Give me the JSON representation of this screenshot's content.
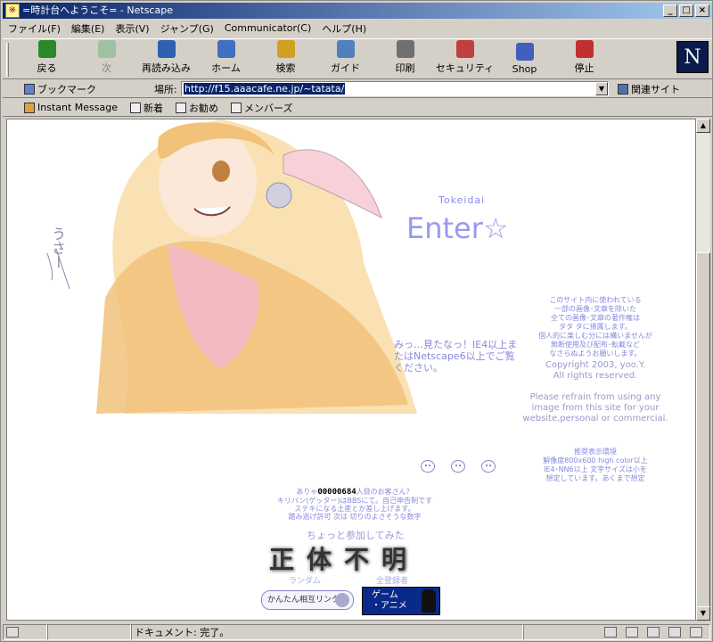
{
  "window": {
    "title": "=時計台へようこそ= - Netscape",
    "controls": {
      "minimize": "_",
      "maximize": "□",
      "close": "×"
    }
  },
  "menu": [
    "ファイル(F)",
    "編集(E)",
    "表示(V)",
    "ジャンプ(G)",
    "Communicator(C)",
    "ヘルプ(H)"
  ],
  "toolbar": [
    {
      "label": "戻る",
      "icon": "back-arrow-icon",
      "color": "#2a8a2a",
      "enabled": true
    },
    {
      "label": "次",
      "icon": "forward-arrow-icon",
      "color": "#60a060",
      "enabled": false
    },
    {
      "label": "再読み込み",
      "icon": "reload-icon",
      "color": "#3060b0",
      "enabled": true
    },
    {
      "label": "ホーム",
      "icon": "home-icon",
      "color": "#4070c0",
      "enabled": true
    },
    {
      "label": "検索",
      "icon": "search-icon",
      "color": "#d0a020",
      "enabled": true
    },
    {
      "label": "ガイド",
      "icon": "guide-icon",
      "color": "#5080c0",
      "enabled": true
    },
    {
      "label": "印刷",
      "icon": "print-icon",
      "color": "#707070",
      "enabled": true
    },
    {
      "label": "セキュリティ",
      "icon": "security-lock-icon",
      "color": "#c04040",
      "enabled": true
    },
    {
      "label": "Shop",
      "icon": "shop-icon",
      "color": "#4060c0",
      "enabled": true
    },
    {
      "label": "停止",
      "icon": "stop-icon",
      "color": "#c03030",
      "enabled": true
    }
  ],
  "netscape_logo": "N",
  "location": {
    "bookmarks_label": "ブックマーク",
    "location_label": "場所:",
    "url": "http://f15.aaacafe.ne.jp/~tatata/",
    "related_label": "関連サイト"
  },
  "personal": [
    "Instant Message",
    "新着",
    "お勧め",
    "メンバーズ"
  ],
  "page": {
    "art_scribble": "うさー",
    "site_name": "Tokeidai",
    "enter": "Enter☆",
    "browser_warning": "みっ…見たなっ！IE4以上またはNetscape6以上でご覧ください。",
    "rights_jp": [
      "このサイト内に使われている",
      "一部の画像･文章を除いた",
      "全ての画像･文章の著作権は",
      "タタ タに帰属します。",
      "個人的に楽しむ分には構いませんが",
      "無断使用及び配布･転載など",
      "なさらぬようお願いします。"
    ],
    "copyright": [
      "Copyright 2003, yoo.Y.",
      "All rights reserved."
    ],
    "please": "Please refrain from using any image from this site for your website,personal or commercial.",
    "env": [
      "推奨表示環境",
      "解像度800x600 high color以上",
      "IE4･NN6以上 文字サイズは小を",
      "想定しています。あくまで想定"
    ],
    "counter_prefix": "ありゃ",
    "counter_value": "00000684",
    "counter_suffix": "人目のお客さん？",
    "counter_lines": [
      "キリバン(ゲッター)はBBSにて。自己申告制です",
      "ステキになる土産とか差し上げます。",
      "踏み逃げ許可  次は  切りのよさそうな数字"
    ],
    "join": "ちょっと参加してみた",
    "banner": "正体不明",
    "random_label": "ランダム",
    "all_label": "全登録者",
    "mutual_link": "かんたん相互リンク",
    "game_anime": [
      "ゲーム",
      "・アニメ"
    ]
  },
  "status": {
    "text": "ドキュメント: 完了。"
  }
}
